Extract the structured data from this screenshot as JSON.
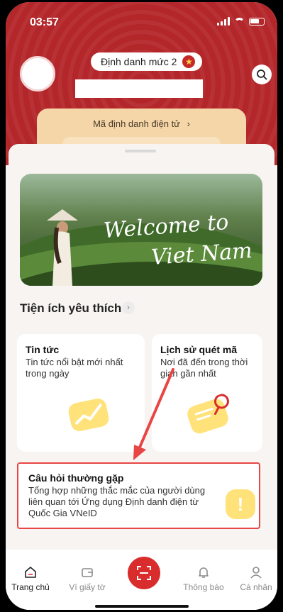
{
  "status": {
    "time": "03:57"
  },
  "header": {
    "level_label": "Định danh mức 2",
    "id_card_label": "Mã định danh điện tử",
    "id_card_chevron": "›"
  },
  "banner": {
    "line1": "Welcome to",
    "line2": "Viet Nam"
  },
  "favorites": {
    "title": "Tiện ích yêu thích",
    "chevron": "›",
    "tiles": [
      {
        "title": "Tin tức",
        "desc": "Tin tức nổi bật mới nhất trong ngày"
      },
      {
        "title": "Lịch sử quét mã",
        "desc": "Nơi đã đến trong thời gian gần nhất"
      }
    ],
    "faq": {
      "title": "Câu hỏi thường gặp",
      "desc": "Tổng hợp những thắc mắc của người dùng liên quan tới Ứng dụng Định danh điện từ Quốc Gia VNeID",
      "icon_glyph": "!"
    }
  },
  "nav": {
    "items": [
      {
        "label": "Trang chủ"
      },
      {
        "label": "Ví giấy tờ"
      },
      {
        "label": "Thông báo"
      },
      {
        "label": "Cá nhân"
      }
    ]
  },
  "colors": {
    "brand_red": "#b3262a",
    "highlight": "#e84545",
    "accent_yellow": "#ffe27a"
  }
}
